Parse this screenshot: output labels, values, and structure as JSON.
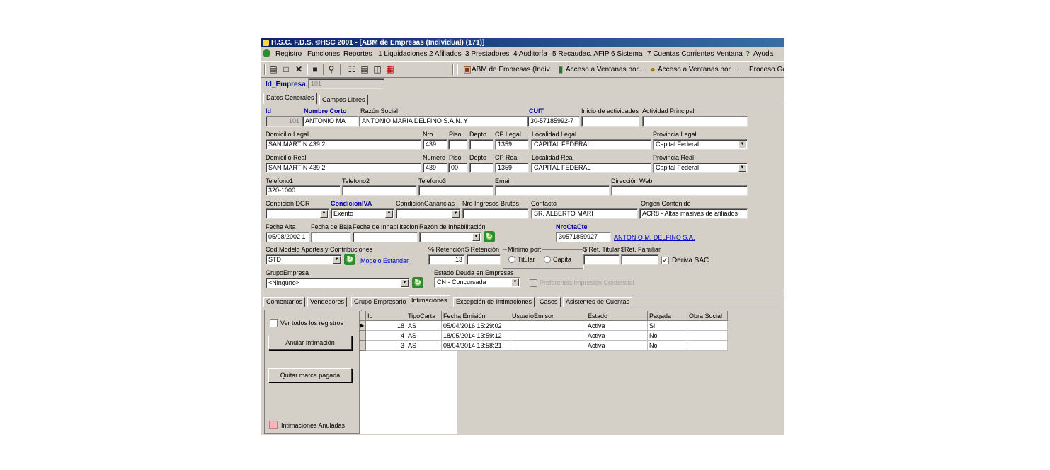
{
  "window": {
    "title": "H.S.C. F.D.S.  ©HSC 2001 - [ABM de Empresas (Individual) (171)]"
  },
  "menu": [
    "Registro",
    "Funciones",
    "Reportes",
    "1 Liquidaciones",
    "2 Afiliados",
    "3 Prestadores",
    "4 Auditoría",
    "5 Recaudac. AFIP",
    "6 Sistema",
    "7 Cuentas Corrientes",
    "Ventana",
    "Ayuda"
  ],
  "toolbar": {
    "links": [
      "ABM de Empresas (Indiv...",
      "Acceso a Ventanas por ...",
      "Acceso a Ventanas por ...",
      "Proceso Ge"
    ]
  },
  "id_empresa": {
    "label": "Id_Empresa:",
    "value": "101"
  },
  "top_tabs": [
    "Datos Generales",
    "Campos Libres"
  ],
  "labels": {
    "id": "Id",
    "nombre_corto": "Nombre Corto",
    "razon_social": "Razón Social",
    "cuit": "CUIT",
    "inicio_actividades": "Inicio de actividades",
    "actividad_principal": "Actividad Principal",
    "domicilio_legal": "Domicilio Legal",
    "nro": "Nro",
    "piso": "Piso",
    "depto": "Depto",
    "cp_legal": "CP Legal",
    "localidad_legal": "Localidad Legal",
    "provincia_legal": "Provincia Legal",
    "domicilio_real": "Domicilio Real",
    "numero": "Numero",
    "piso2": "Piso",
    "depto2": "Depto",
    "cp_real": "CP Real",
    "localidad_real": "Localidad Real",
    "provincia_real": "Provincia Real",
    "telefono1": "Telefono1",
    "telefono2": "Telefono2",
    "telefono3": "Telefono3",
    "email": "Email",
    "web": "Dirección Web",
    "condicion_dgr": "Condicion DGR",
    "condicion_iva": "CondicionIVA",
    "condicion_ganancias": "CondicionGanancias",
    "nro_ingresos_brutos": "Nro Ingresos Brutos",
    "contacto": "Contacto",
    "origen_contenido": "Origen Contenido",
    "fecha_alta": "Fecha Alta",
    "fecha_baja": "Fecha de Baja",
    "fecha_inhabilitacion": "Fecha de Inhabilitación",
    "razon_inhabilitacion": "Razón de Inhabilitación",
    "nro_cta_cte": "NroCtaCte",
    "cod_modelo": "Cod.Modelo Aportes y Contribuciones",
    "pct_retencion": "% Retención",
    "monto_retencion": "$ Retención",
    "minimo_por": "Mínimo por:",
    "ret_titular": "$ Ret. Titular",
    "ret_familiar": "$Ret. Familiar",
    "grupo_empresa": "GrupoEmpresa",
    "estado_deuda": "Estado Deuda en Empresas"
  },
  "values": {
    "id": "101",
    "nombre_corto": "ANTONIO MA",
    "razon_social": "ANTONIO MARIA DELFINO S.A.N. Y",
    "cuit": "30-57185992-7",
    "domicilio_legal": "SAN MARTIN 439 2",
    "nro": "439",
    "cp_legal": "1359",
    "localidad_legal": "CAPITAL FEDERAL",
    "provincia_legal": "Capital Federal",
    "domicilio_real": "SAN MARTIN 439 2",
    "numero": "439",
    "piso": "00",
    "cp_real": "1359",
    "localidad_real": "CAPITAL FEDERAL",
    "provincia_real": "Capital Federal",
    "telefono1": "320-1000",
    "condicion_iva": "Exento",
    "contacto": "SR. ALBERTO MARI",
    "origen_contenido": "ACR8 - Altas masivas de afiliados",
    "fecha_alta": "05/08/2002 1",
    "nro_cta_cte": "30571859927",
    "nro_cta_cte_link": "ANTONIO M. DELFINO S.A.",
    "cod_modelo": "STD",
    "modelo_link": "Modelo Estandar",
    "pct_retencion": "13",
    "grupo_empresa": "<Ninguno>",
    "estado_deuda": "CN - Concursada"
  },
  "options": {
    "titular": "Titular",
    "capita": "Cápita",
    "deriva_sac": "Deriva SAC",
    "preferencia": "Preferencia Impresión Credencial"
  },
  "bottom_tabs": [
    "Comentarios",
    "Vendedores",
    "Grupo Empresario",
    "Intimaciones",
    "Excepción de Intimaciones",
    "Casos",
    "Asistentes de Cuentas"
  ],
  "intimaciones": {
    "ver_todos": "Ver todos los registros",
    "anular": "Anular Intimación",
    "quitar": "Quitar marca pagada",
    "legend": "Intimaciones Anuladas",
    "columns": [
      "Id",
      "TipoCarta",
      "Fecha Emisión",
      "UsuarioEmisor",
      "Estado",
      "Pagada",
      "Obra Social"
    ],
    "rows": [
      [
        "18",
        "AS",
        "05/04/2016 15:29:02",
        "",
        "Activa",
        "Si",
        ""
      ],
      [
        "4",
        "AS",
        "18/05/2014 13:59:12",
        "",
        "Activa",
        "No",
        ""
      ],
      [
        "3",
        "AS",
        "08/04/2014 13:58:21",
        "",
        "Activa",
        "No",
        ""
      ]
    ]
  }
}
